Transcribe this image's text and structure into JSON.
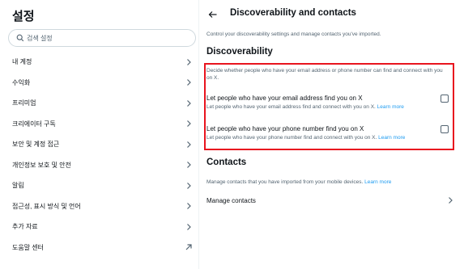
{
  "settings": {
    "title": "설정",
    "search_placeholder": "검색 설정",
    "items": [
      {
        "label": "내 계정",
        "icon": "chevron-right-icon"
      },
      {
        "label": "수익화",
        "icon": "chevron-right-icon"
      },
      {
        "label": "프리미엄",
        "icon": "chevron-right-icon"
      },
      {
        "label": "크리에이터 구독",
        "icon": "chevron-right-icon"
      },
      {
        "label": "보안 및 계정 접근",
        "icon": "chevron-right-icon"
      },
      {
        "label": "개인정보 보호 및 안전",
        "icon": "chevron-right-icon"
      },
      {
        "label": "알림",
        "icon": "chevron-right-icon"
      },
      {
        "label": "접근성, 표시 방식 및 언어",
        "icon": "chevron-right-icon"
      },
      {
        "label": "추가 자료",
        "icon": "chevron-right-icon"
      },
      {
        "label": "도움말 센터",
        "icon": "external-arrow-icon"
      }
    ]
  },
  "panel": {
    "title": "Discoverability and contacts",
    "description": "Control your discoverability settings and manage contacts you've imported.",
    "discoverability": {
      "heading": "Discoverability",
      "intro": "Decide whether people who have your email address or phone number can find and connect with you on X.",
      "email": {
        "title": "Let people who have your email address find you on X",
        "sub": "Let people who have your email address find and connect with you on X.",
        "link": "Learn more",
        "checked": false
      },
      "phone": {
        "title": "Let people who have your phone number find you on X",
        "sub": "Let people who have your phone number find and connect with you on X.",
        "link": "Learn more",
        "checked": false
      }
    },
    "contacts": {
      "heading": "Contacts",
      "sub": "Manage contacts that you have imported from your mobile devices.",
      "link": "Learn more",
      "manage_label": "Manage contacts"
    }
  },
  "colors": {
    "highlight_border": "#e8141e",
    "link": "#1d9bf0",
    "muted_text": "#536471"
  }
}
